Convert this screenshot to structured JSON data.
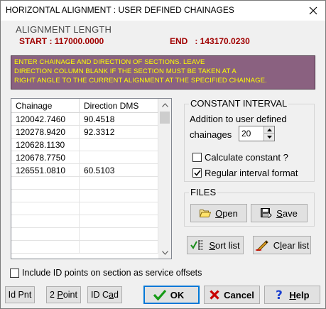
{
  "window": {
    "title": "HORIZONTAL ALIGNMENT : USER DEFINED CHAINAGES",
    "close_icon": "close-icon"
  },
  "alignment_length": {
    "label": "ALIGNMENT LENGTH",
    "start": "START : 117000.0000",
    "end": "END   : 143170.0230",
    "color": "#a00000"
  },
  "info": {
    "lines": [
      "ENTER CHAINAGE AND DIRECTION OF SECTIONS. LEAVE",
      "DIRECTION COLUMN BLANK IF THE SECTION MUST BE TAKEN AT A",
      "RIGHT ANGLE TO THE CURRENT ALIGNMENT AT THE SPECIFIED CHAINAGE."
    ],
    "background": "#8a6180",
    "text_color": "#ffff00"
  },
  "grid": {
    "columns": [
      "Chainage",
      "Direction DMS"
    ],
    "rows": [
      [
        "120042.7460",
        "90.4518"
      ],
      [
        "120278.9420",
        "92.3312"
      ],
      [
        "120628.1130",
        ""
      ],
      [
        "120678.7750",
        ""
      ],
      [
        "126551.0810",
        "60.5103"
      ],
      [
        "",
        ""
      ],
      [
        "",
        ""
      ],
      [
        "",
        ""
      ],
      [
        "",
        ""
      ],
      [
        "",
        ""
      ],
      [
        "",
        ""
      ]
    ]
  },
  "constant_interval": {
    "title": "CONSTANT INTERVAL",
    "line1": "Addition to user defined",
    "line2": "chainages",
    "value": "20",
    "calc_label": "Calculate constant ?",
    "calc_checked": false,
    "regular_label": "Regular interval format",
    "regular_checked": true
  },
  "files": {
    "title": "FILES",
    "open_prefix": "",
    "open_u": "O",
    "open_rest": "pen",
    "save_prefix": "",
    "save_u": "S",
    "save_rest": "ave"
  },
  "list_buttons": {
    "sort_u": "S",
    "sort_rest": "ort list",
    "clear_prefix": "C",
    "clear_u": "l",
    "clear_rest": "ear list"
  },
  "include_id": {
    "label": "Include ID points on section as service offsets",
    "checked": false
  },
  "bottom": {
    "idpnt": "Id Pnt",
    "two_point_prefix": "2 ",
    "two_point_u": "P",
    "two_point_rest": "oint",
    "idcad_prefix": "ID C",
    "idcad_u": "a",
    "idcad_rest": "d",
    "ok": "OK",
    "cancel": "Cancel",
    "help_u": "H",
    "help_rest": "elp"
  }
}
